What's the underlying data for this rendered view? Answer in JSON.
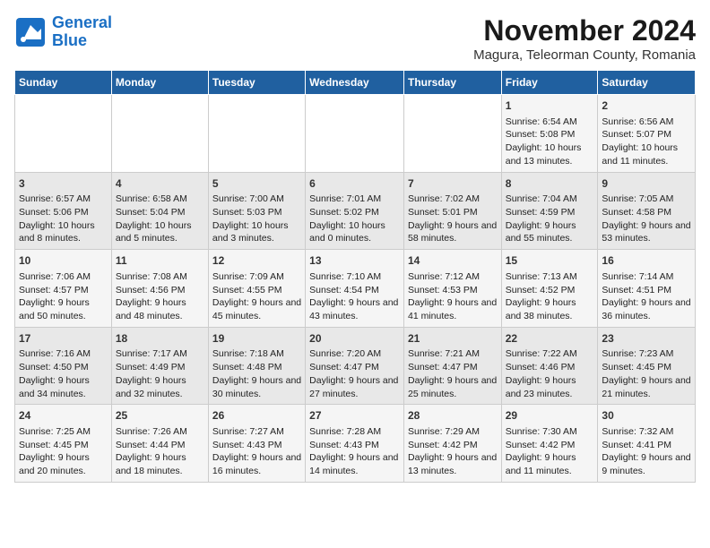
{
  "logo": {
    "line1": "General",
    "line2": "Blue"
  },
  "title": "November 2024",
  "location": "Magura, Teleorman County, Romania",
  "weekdays": [
    "Sunday",
    "Monday",
    "Tuesday",
    "Wednesday",
    "Thursday",
    "Friday",
    "Saturday"
  ],
  "weeks": [
    [
      {
        "day": "",
        "info": ""
      },
      {
        "day": "",
        "info": ""
      },
      {
        "day": "",
        "info": ""
      },
      {
        "day": "",
        "info": ""
      },
      {
        "day": "",
        "info": ""
      },
      {
        "day": "1",
        "info": "Sunrise: 6:54 AM\nSunset: 5:08 PM\nDaylight: 10 hours and 13 minutes."
      },
      {
        "day": "2",
        "info": "Sunrise: 6:56 AM\nSunset: 5:07 PM\nDaylight: 10 hours and 11 minutes."
      }
    ],
    [
      {
        "day": "3",
        "info": "Sunrise: 6:57 AM\nSunset: 5:06 PM\nDaylight: 10 hours and 8 minutes."
      },
      {
        "day": "4",
        "info": "Sunrise: 6:58 AM\nSunset: 5:04 PM\nDaylight: 10 hours and 5 minutes."
      },
      {
        "day": "5",
        "info": "Sunrise: 7:00 AM\nSunset: 5:03 PM\nDaylight: 10 hours and 3 minutes."
      },
      {
        "day": "6",
        "info": "Sunrise: 7:01 AM\nSunset: 5:02 PM\nDaylight: 10 hours and 0 minutes."
      },
      {
        "day": "7",
        "info": "Sunrise: 7:02 AM\nSunset: 5:01 PM\nDaylight: 9 hours and 58 minutes."
      },
      {
        "day": "8",
        "info": "Sunrise: 7:04 AM\nSunset: 4:59 PM\nDaylight: 9 hours and 55 minutes."
      },
      {
        "day": "9",
        "info": "Sunrise: 7:05 AM\nSunset: 4:58 PM\nDaylight: 9 hours and 53 minutes."
      }
    ],
    [
      {
        "day": "10",
        "info": "Sunrise: 7:06 AM\nSunset: 4:57 PM\nDaylight: 9 hours and 50 minutes."
      },
      {
        "day": "11",
        "info": "Sunrise: 7:08 AM\nSunset: 4:56 PM\nDaylight: 9 hours and 48 minutes."
      },
      {
        "day": "12",
        "info": "Sunrise: 7:09 AM\nSunset: 4:55 PM\nDaylight: 9 hours and 45 minutes."
      },
      {
        "day": "13",
        "info": "Sunrise: 7:10 AM\nSunset: 4:54 PM\nDaylight: 9 hours and 43 minutes."
      },
      {
        "day": "14",
        "info": "Sunrise: 7:12 AM\nSunset: 4:53 PM\nDaylight: 9 hours and 41 minutes."
      },
      {
        "day": "15",
        "info": "Sunrise: 7:13 AM\nSunset: 4:52 PM\nDaylight: 9 hours and 38 minutes."
      },
      {
        "day": "16",
        "info": "Sunrise: 7:14 AM\nSunset: 4:51 PM\nDaylight: 9 hours and 36 minutes."
      }
    ],
    [
      {
        "day": "17",
        "info": "Sunrise: 7:16 AM\nSunset: 4:50 PM\nDaylight: 9 hours and 34 minutes."
      },
      {
        "day": "18",
        "info": "Sunrise: 7:17 AM\nSunset: 4:49 PM\nDaylight: 9 hours and 32 minutes."
      },
      {
        "day": "19",
        "info": "Sunrise: 7:18 AM\nSunset: 4:48 PM\nDaylight: 9 hours and 30 minutes."
      },
      {
        "day": "20",
        "info": "Sunrise: 7:20 AM\nSunset: 4:47 PM\nDaylight: 9 hours and 27 minutes."
      },
      {
        "day": "21",
        "info": "Sunrise: 7:21 AM\nSunset: 4:47 PM\nDaylight: 9 hours and 25 minutes."
      },
      {
        "day": "22",
        "info": "Sunrise: 7:22 AM\nSunset: 4:46 PM\nDaylight: 9 hours and 23 minutes."
      },
      {
        "day": "23",
        "info": "Sunrise: 7:23 AM\nSunset: 4:45 PM\nDaylight: 9 hours and 21 minutes."
      }
    ],
    [
      {
        "day": "24",
        "info": "Sunrise: 7:25 AM\nSunset: 4:45 PM\nDaylight: 9 hours and 20 minutes."
      },
      {
        "day": "25",
        "info": "Sunrise: 7:26 AM\nSunset: 4:44 PM\nDaylight: 9 hours and 18 minutes."
      },
      {
        "day": "26",
        "info": "Sunrise: 7:27 AM\nSunset: 4:43 PM\nDaylight: 9 hours and 16 minutes."
      },
      {
        "day": "27",
        "info": "Sunrise: 7:28 AM\nSunset: 4:43 PM\nDaylight: 9 hours and 14 minutes."
      },
      {
        "day": "28",
        "info": "Sunrise: 7:29 AM\nSunset: 4:42 PM\nDaylight: 9 hours and 13 minutes."
      },
      {
        "day": "29",
        "info": "Sunrise: 7:30 AM\nSunset: 4:42 PM\nDaylight: 9 hours and 11 minutes."
      },
      {
        "day": "30",
        "info": "Sunrise: 7:32 AM\nSunset: 4:41 PM\nDaylight: 9 hours and 9 minutes."
      }
    ]
  ]
}
